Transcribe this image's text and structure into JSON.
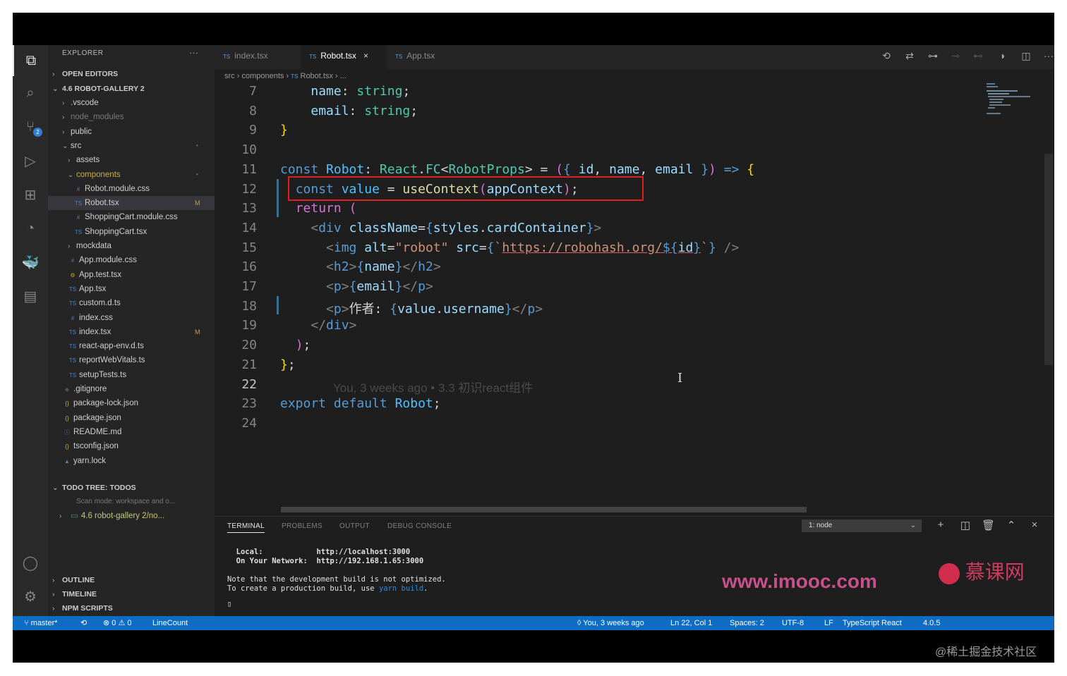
{
  "explorer": {
    "title": "EXPLORER",
    "more": "···",
    "open_editors": "OPEN EDITORS",
    "project": "4.6 ROBOT-GALLERY 2",
    "tree": [
      {
        "name": ".vscode",
        "icon": "›",
        "mark": ""
      },
      {
        "name": "node_modules",
        "icon": "›",
        "mark": ""
      },
      {
        "name": "public",
        "icon": "›",
        "mark": ""
      },
      {
        "name": "src",
        "icon": "⌄",
        "mark": "•"
      },
      {
        "name": "assets",
        "icon": "›",
        "mark": ""
      },
      {
        "name": "components",
        "icon": "⌄",
        "mark": "•"
      },
      {
        "name": "Robot.module.css",
        "icon": "#",
        "mark": ""
      },
      {
        "name": "Robot.tsx",
        "icon": "TS",
        "mark": "M"
      },
      {
        "name": "ShoppingCart.module.css",
        "icon": "#",
        "mark": ""
      },
      {
        "name": "ShoppingCart.tsx",
        "icon": "TS",
        "mark": ""
      },
      {
        "name": "mockdata",
        "icon": "›",
        "mark": ""
      },
      {
        "name": "App.module.css",
        "icon": "#",
        "mark": ""
      },
      {
        "name": "App.test.tsx",
        "icon": "⚙",
        "mark": ""
      },
      {
        "name": "App.tsx",
        "icon": "TS",
        "mark": ""
      },
      {
        "name": "custom.d.ts",
        "icon": "TS",
        "mark": ""
      },
      {
        "name": "index.css",
        "icon": "#",
        "mark": ""
      },
      {
        "name": "index.tsx",
        "icon": "TS",
        "mark": "M"
      },
      {
        "name": "react-app-env.d.ts",
        "icon": "TS",
        "mark": ""
      },
      {
        "name": "reportWebVitals.ts",
        "icon": "TS",
        "mark": ""
      },
      {
        "name": "setupTests.ts",
        "icon": "TS",
        "mark": ""
      },
      {
        "name": ".gitignore",
        "icon": "◆",
        "mark": ""
      },
      {
        "name": "package-lock.json",
        "icon": "{}",
        "mark": ""
      },
      {
        "name": "package.json",
        "icon": "{}",
        "mark": ""
      },
      {
        "name": "README.md",
        "icon": "ⓘ",
        "mark": ""
      },
      {
        "name": "tsconfig.json",
        "icon": "{}",
        "mark": ""
      },
      {
        "name": "yarn.lock",
        "icon": "▲",
        "mark": ""
      }
    ],
    "todo_tree": "TODO TREE: TODOS",
    "scan_mode": "Scan mode: workspace and o...",
    "todo_item": "4.6 robot-gallery 2/no...",
    "outline": "OUTLINE",
    "timeline": "TIMELINE",
    "npm_scripts": "NPM SCRIPTS"
  },
  "tabs": [
    {
      "label": "index.tsx",
      "prefix": "TS"
    },
    {
      "label": "Robot.tsx",
      "prefix": "TS",
      "close": "×"
    },
    {
      "label": "App.tsx",
      "prefix": "TS"
    }
  ],
  "breadcrumb": {
    "src": "src",
    "components": "components",
    "file": "Robot.tsx",
    "tail": "...",
    "sep": "›",
    "ts": "TS"
  },
  "editor": {
    "line_numbers": [
      "7",
      "8",
      "9",
      "10",
      "11",
      "12",
      "13",
      "14",
      "15",
      "16",
      "17",
      "18",
      "19",
      "20",
      "21",
      "22",
      "23",
      "24"
    ],
    "current_line": "22",
    "blame": "You, 3 weeks ago • 3.3 初识react组件"
  },
  "panel": {
    "tabs": [
      "TERMINAL",
      "PROBLEMS",
      "OUTPUT",
      "DEBUG CONSOLE"
    ],
    "terminal_select": "1: node",
    "lines": {
      "local_label": "  Local:            ",
      "local_url": "http://localhost:3000",
      "network_label": "  On Your Network:  ",
      "network_url": "http://192.168.1.65:3000",
      "note": "Note that the development build is not optimized.",
      "create_prefix": "To create a production build, use ",
      "create_cmd": "yarn build",
      "create_suffix": ".",
      "prompt": "▯"
    }
  },
  "status": {
    "branch": "master*",
    "sync": "⟲",
    "errors": "⊗ 0",
    "warnings": "⚠ 0",
    "linecount": "LineCount",
    "blame": "You, 3 weeks ago",
    "position": "Ln 22, Col 1",
    "spaces": "Spaces: 2",
    "encoding": "UTF-8",
    "eol": "LF",
    "language": "TypeScript React",
    "version": "4.0.5",
    "color": "#0e6cc4"
  },
  "watermarks": {
    "site": "www.imooc.com",
    "brand": "慕课网",
    "credit": "@稀土掘金技术社区"
  }
}
